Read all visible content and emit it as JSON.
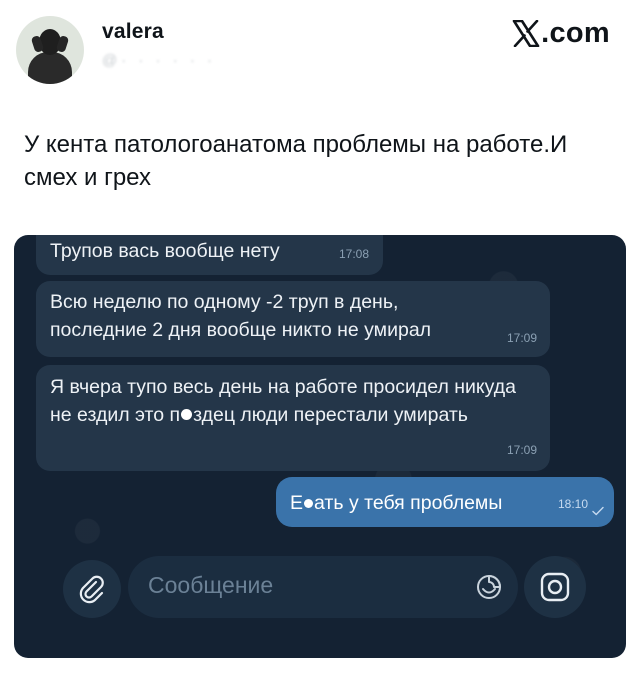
{
  "post": {
    "author_name": "valera",
    "author_handle": "@·  ·  ·  ·  ·  ·",
    "brand": ".com",
    "text": "У кента патологоанатома проблемы на работе.И смех и грех"
  },
  "chat": {
    "messages": [
      {
        "text": "Трупов вась вообще нету",
        "time": "17:08",
        "direction": "incoming"
      },
      {
        "text": "Всю неделю по одному -2 труп в день, последние 2 дня вообще никто не умирал",
        "time": "17:09",
        "direction": "incoming"
      },
      {
        "text_before": "Я вчера тупо весь день на работе просидел никуда не ездил это п",
        "text_after": "здец люди перестали умирать",
        "time": "17:09",
        "direction": "incoming"
      },
      {
        "text_before": "Е",
        "text_after": "ать у тебя проблемы",
        "time": "18:10",
        "direction": "outgoing",
        "status_icon": "read-check-icon"
      }
    ],
    "composer": {
      "placeholder": "Сообщение",
      "attach_icon": "paperclip-icon",
      "sticker_icon": "sticker-icon",
      "camera_icon": "camera-icon"
    }
  },
  "colors": {
    "chat_background": "#142233",
    "incoming_bubble": "#243649",
    "outgoing_bubble": "#3a73aa"
  }
}
